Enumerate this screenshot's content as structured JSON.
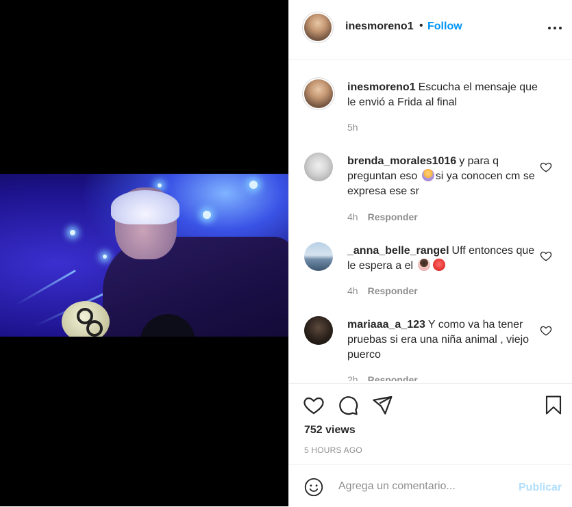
{
  "post": {
    "author": "inesmoreno1",
    "follow_label": "Follow",
    "separator": "•",
    "caption_text": "Escucha el mensaje que le envió a Frida al final",
    "caption_time": "5h"
  },
  "comments": [
    {
      "user": "brenda_morales1016",
      "text_before": "y para q preguntan eso",
      "text_after": "si ya conocen cm se expresa ese sr",
      "time": "4h",
      "reply_label": "Responder"
    },
    {
      "user": "_anna_belle_rangel",
      "text_before": "Uff entonces que le espera a el",
      "text_after": "",
      "time": "4h",
      "reply_label": "Responder"
    },
    {
      "user": "mariaaa_a_123",
      "text_before": "Y como va ha tener pruebas si era una niña animal , viejo puerco",
      "text_after": "",
      "time": "2h",
      "reply_label": "Responder"
    }
  ],
  "stats": {
    "views": "752 views",
    "timestamp": "5 HOURS AGO"
  },
  "composer": {
    "placeholder": "Agrega un comentario...",
    "publish_label": "Publicar"
  },
  "icons": {
    "like": "heart-icon",
    "comment": "comment-icon",
    "share": "share-icon",
    "save": "bookmark-icon",
    "emoji": "emoji-icon",
    "more": "more-options-icon"
  },
  "colors": {
    "link": "#0095f6",
    "publish_disabled": "#b2dffc",
    "muted": "#8e8e8e"
  }
}
